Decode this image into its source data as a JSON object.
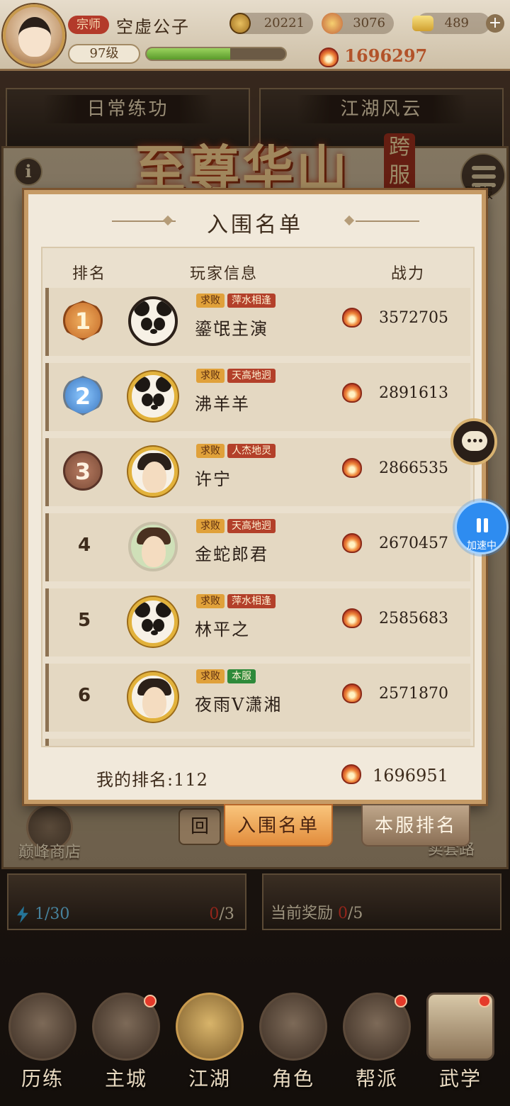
{
  "header": {
    "rank_title": "宗师",
    "player_name": "空虚公子",
    "level": "97级",
    "exp_fraction": 0.6,
    "coins": "20221",
    "gems": "3076",
    "gold": "489",
    "power": "1696297"
  },
  "background": {
    "tab_daily": "日常练功",
    "tab_jianghu": "江湖风云",
    "event_title": "至尊华山",
    "cross_server": "跨服",
    "cross_label": "跨服",
    "shop_label": "巅峰商店",
    "right_label": "卖套路",
    "back_label": "回",
    "card1_count": "1/30",
    "card1_red_a": "0",
    "card1_red_b": "/3",
    "card2_prefix": "当前奖励 ",
    "card2_red": "0",
    "card2_suffix": "/5"
  },
  "modal": {
    "title": "入围名单",
    "col_rank": "排名",
    "col_player": "玩家信息",
    "col_power": "战力",
    "my_rank_label": "我的排名:112",
    "my_power": "1696951",
    "tab_active": "入围名单",
    "tab_other": "本服排名"
  },
  "players": [
    {
      "rank": "1",
      "title_tag": "求败",
      "server_tag": "萍水相逢",
      "name": "鎏氓主演",
      "power": "3572705"
    },
    {
      "rank": "2",
      "title_tag": "求败",
      "server_tag": "天高地迥",
      "name": "沸羊羊",
      "power": "2891613"
    },
    {
      "rank": "3",
      "title_tag": "求败",
      "server_tag": "人杰地灵",
      "name": "许宁",
      "power": "2866535"
    },
    {
      "rank": "4",
      "title_tag": "求败",
      "server_tag": "天高地迥",
      "name": "金蛇郎君",
      "power": "2670457"
    },
    {
      "rank": "5",
      "title_tag": "求败",
      "server_tag": "萍水相逢",
      "name": "林平之",
      "power": "2585683"
    },
    {
      "rank": "6",
      "title_tag": "求败",
      "server_tag": "本服",
      "name": "夜雨V潇湘",
      "power": "2571870"
    }
  ],
  "floating": {
    "speed_label": "加速中"
  },
  "nav": [
    {
      "label": "历练"
    },
    {
      "label": "主城"
    },
    {
      "label": "江湖"
    },
    {
      "label": "角色"
    },
    {
      "label": "帮派"
    },
    {
      "label": "武学"
    }
  ],
  "colors": {
    "accent": "#e28c3c",
    "panel": "#f1e9db",
    "server_tag": "#b3402a",
    "home_server_tag": "#2e8a3a"
  }
}
